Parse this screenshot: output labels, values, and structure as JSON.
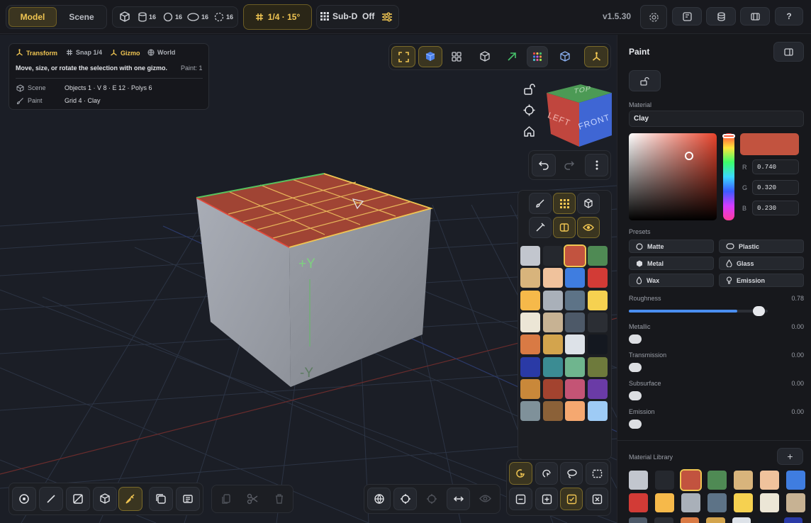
{
  "topbar": {
    "mode_model": "Model",
    "mode_scene": "Scene",
    "counts": [
      "16",
      "16",
      "16",
      "16"
    ],
    "snap": "1/4 · 15°",
    "subd": "Sub-D  Off",
    "version": "v1.5.30"
  },
  "info": {
    "transform": "Transform",
    "snap": "Snap 1/4",
    "gizmo": "Gizmo",
    "world": "World",
    "description": "Move, size, or rotate the selection with one gizmo.",
    "paint_count": "Paint: 1",
    "scene_label": "Scene",
    "scene_value": "Objects 1 · V 8 · E 12 · Polys 6",
    "paint_label": "Paint",
    "paint_value": "Grid 4 · Clay"
  },
  "viewport": {
    "axis_plus_y": "+Y",
    "axis_minus_y": "-Y",
    "navcube_top": "TOP",
    "navcube_left": "LEFT",
    "navcube_front": "FRONT"
  },
  "palette_colors": [
    "#c2c6ce",
    "#25282e",
    "#c2533f",
    "#4f8a54",
    "#d8b47c",
    "#f0c29c",
    "#3f7de0",
    "#d23b36",
    "#f6b94a",
    "#a9b0b9",
    "#5d7387",
    "#f6d150",
    "#ece6d6",
    "#c7b293",
    "#4d5968",
    "#2b2e34",
    "#d97a44",
    "#d3a44d",
    "#dde2e8",
    "#141820",
    "#2a3aa6",
    "#3b8c93",
    "#6fb58e",
    "#6e7a3c",
    "#c9883a",
    "#a3432f",
    "#c45475",
    "#6a3ba6",
    "#7f919a",
    "#8b6138",
    "#f5a870",
    "#9ecbf5"
  ],
  "panel": {
    "title": "Paint",
    "material_label": "Material",
    "material_value": "Clay",
    "swatch_color": "#c2533f",
    "r_label": "R",
    "r_value": "0.740",
    "g_label": "G",
    "g_value": "0.320",
    "b_label": "B",
    "b_value": "0.230",
    "presets_label": "Presets",
    "presets": [
      "Matte",
      "Plastic",
      "Metal",
      "Glass",
      "Wax",
      "Emission"
    ],
    "sliders": [
      {
        "label": "Roughness",
        "value": "0.78"
      },
      {
        "label": "Metallic",
        "value": "0.00"
      },
      {
        "label": "Transmission",
        "value": "0.00"
      },
      {
        "label": "Subsurface",
        "value": "0.00"
      },
      {
        "label": "Emission",
        "value": "0.00"
      }
    ],
    "roughness_fraction": 0.78,
    "library_label": "Material Library",
    "library_colors": [
      "#c2c6ce",
      "#25282e",
      "#c2533f",
      "#4f8a54",
      "#d8b47c",
      "#f0c29c",
      "#3f7de0",
      "#d23b36",
      "#f6b94a",
      "#a9b0b9",
      "#5d7387",
      "#f6d150",
      "#ece6d6",
      "#c7b293"
    ]
  },
  "accent": "#f0c552"
}
